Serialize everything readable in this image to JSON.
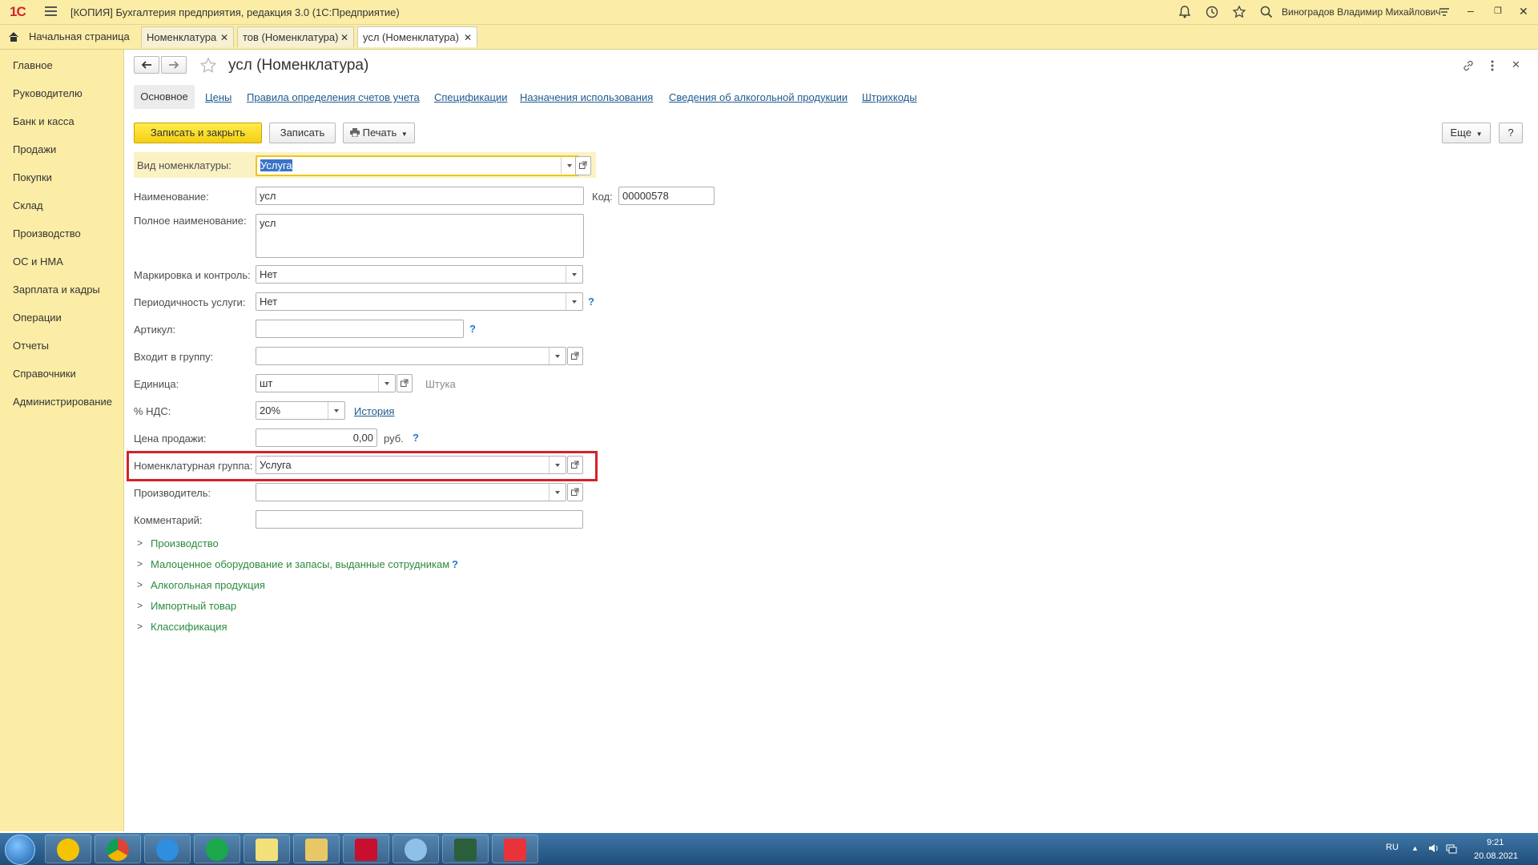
{
  "app": {
    "logo": "1С",
    "title": "[КОПИЯ] Бухгалтерия предприятия, редакция 3.0  (1С:Предприятие)",
    "user": "Виноградов Владимир Михайлович"
  },
  "tabs": [
    {
      "label": "Начальная страница"
    },
    {
      "label": "Номенклатура"
    },
    {
      "label": "тов (Номенклатура)"
    },
    {
      "label": "усл (Номенклатура)"
    }
  ],
  "sidebar": {
    "items": [
      {
        "label": "Главное"
      },
      {
        "label": "Руководителю"
      },
      {
        "label": "Банк и касса"
      },
      {
        "label": "Продажи"
      },
      {
        "label": "Покупки"
      },
      {
        "label": "Склад"
      },
      {
        "label": "Производство"
      },
      {
        "label": "ОС и НМА"
      },
      {
        "label": "Зарплата и кадры"
      },
      {
        "label": "Операции"
      },
      {
        "label": "Отчеты"
      },
      {
        "label": "Справочники"
      },
      {
        "label": "Администрирование"
      }
    ]
  },
  "form": {
    "title": "усл (Номенклатура)",
    "sections": [
      {
        "label": "Основное"
      },
      {
        "label": "Цены"
      },
      {
        "label": "Правила определения счетов учета"
      },
      {
        "label": "Спецификации"
      },
      {
        "label": "Назначения использования"
      },
      {
        "label": "Сведения об алкогольной продукции"
      },
      {
        "label": "Штрихкоды"
      }
    ],
    "buttons": {
      "save_close": "Записать и закрыть",
      "save": "Записать",
      "print": "Печать",
      "more": "Еще",
      "help": "?"
    },
    "fields": {
      "kind_label": "Вид номенклатуры:",
      "kind_value": "Услуга",
      "name_label": "Наименование:",
      "name_value": "усл",
      "code_label": "Код:",
      "code_value": "00000578",
      "fullname_label": "Полное наименование:",
      "fullname_value": "усл",
      "marking_label": "Маркировка и контроль:",
      "marking_value": "Нет",
      "period_label": "Периодичность услуги:",
      "period_value": "Нет",
      "article_label": "Артикул:",
      "article_value": "",
      "group_label": "Входит в группу:",
      "group_value": "",
      "unit_label": "Единица:",
      "unit_value": "шт",
      "unit_hint": "Штука",
      "vat_label": "% НДС:",
      "vat_value": "20%",
      "vat_history": "История",
      "price_label": "Цена продажи:",
      "price_value": "0,00",
      "price_currency": "руб.",
      "nomgroup_label": "Номенклатурная группа:",
      "nomgroup_value": "Услуга",
      "maker_label": "Производитель:",
      "maker_value": "",
      "comment_label": "Комментарий:",
      "comment_value": ""
    },
    "groups": [
      {
        "label": "Производство"
      },
      {
        "label": "Малоценное оборудование и запасы, выданные сотрудникам"
      },
      {
        "label": "Алкогольная продукция"
      },
      {
        "label": "Импортный товар"
      },
      {
        "label": "Классификация"
      }
    ],
    "help_mark": "?"
  },
  "taskbar": {
    "lang": "RU",
    "time": "9:21",
    "date": "20.08.2021"
  },
  "colors": {
    "accent_yellow": "#fbeda6",
    "highlight_red": "#d2232a",
    "link_blue": "#1f5a8f",
    "group_green": "#2c8a3e"
  }
}
